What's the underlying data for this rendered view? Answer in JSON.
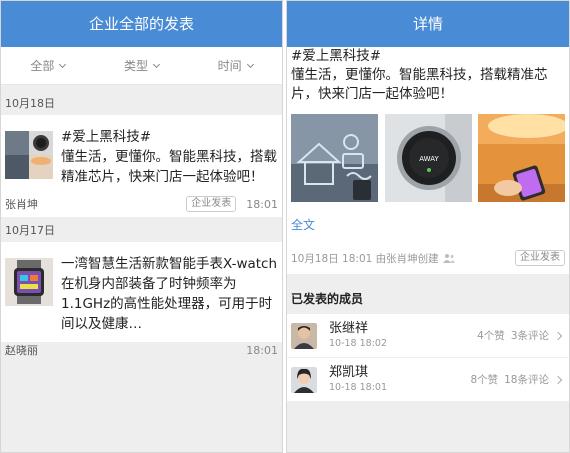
{
  "left": {
    "title": "企业全部的发表",
    "filters": [
      {
        "label": "全部"
      },
      {
        "label": "类型"
      },
      {
        "label": "时间"
      }
    ],
    "groups": [
      {
        "date": "10月18日",
        "post": {
          "text": "#爱上黑科技#\n懂生活，更懂你。智能黑科技，搭载精准芯片，快来门店一起体验吧！",
          "author": "张肖坤",
          "tag": "企业发表",
          "time": "18:01"
        }
      },
      {
        "date": "10月17日",
        "post": {
          "text": "一湾智慧生活新款智能手表X-watch在机身内部装备了时钟频率为1.1GHz的高性能处理器，可用于时间以及健康…",
          "author": "赵晓丽",
          "tag": "",
          "time": "18:01"
        }
      }
    ]
  },
  "right": {
    "title": "详情",
    "text_line1": "#爱上黑科技#",
    "text_line2": "懂生活，更懂你。智能黑科技，搭载精准芯片，快来门店一起体验吧！",
    "full_text_link": "全文",
    "meta": "10月18日 18:01 由张肖坤创建",
    "tag": "企业发表",
    "members_header": "已发表的成员",
    "members": [
      {
        "name": "张继祥",
        "date": "10-18 18:02",
        "likes": "4个赞",
        "comments": "3条评论"
      },
      {
        "name": "郑凯琪",
        "date": "10-18 18:01",
        "likes": "8个赞",
        "comments": "18条评论"
      }
    ]
  }
}
